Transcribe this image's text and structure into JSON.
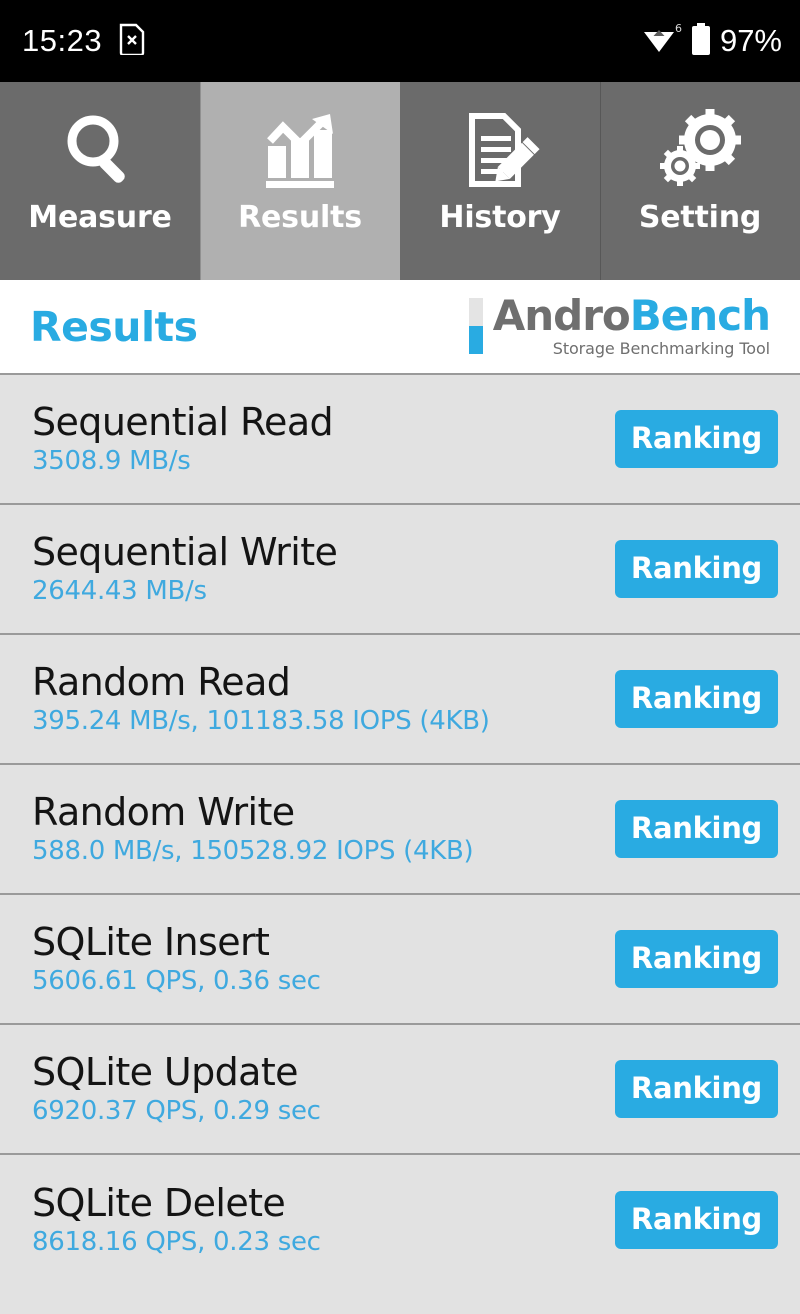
{
  "status_bar": {
    "time": "15:23",
    "sim_icon": "sim-card-off-icon",
    "wifi_icon": "wifi-6-icon",
    "wifi_generation": "6",
    "battery_icon": "battery-icon",
    "battery_percent": "97%"
  },
  "tabs": [
    {
      "label": "Measure",
      "icon": "magnifier-icon",
      "selected": false
    },
    {
      "label": "Results",
      "icon": "bar-chart-trend-icon",
      "selected": true
    },
    {
      "label": "History",
      "icon": "document-pencil-icon",
      "selected": false
    },
    {
      "label": "Setting",
      "icon": "gears-icon",
      "selected": false
    }
  ],
  "header": {
    "page_title": "Results",
    "logo": {
      "name_first": "Andro",
      "name_second": "Bench",
      "tagline": "Storage Benchmarking Tool"
    }
  },
  "results": [
    {
      "title": "Sequential Read",
      "value": "3508.9 MB/s",
      "button": "Ranking"
    },
    {
      "title": "Sequential Write",
      "value": "2644.43 MB/s",
      "button": "Ranking"
    },
    {
      "title": "Random Read",
      "value": "395.24 MB/s, 101183.58 IOPS (4KB)",
      "button": "Ranking"
    },
    {
      "title": "Random Write",
      "value": "588.0 MB/s, 150528.92 IOPS (4KB)",
      "button": "Ranking"
    },
    {
      "title": "SQLite Insert",
      "value": "5606.61 QPS, 0.36 sec",
      "button": "Ranking"
    },
    {
      "title": "SQLite Update",
      "value": "6920.37 QPS, 0.29 sec",
      "button": "Ranking"
    },
    {
      "title": "SQLite Delete",
      "value": "8618.16 QPS, 0.23 sec",
      "button": "Ranking"
    }
  ],
  "colors": {
    "accent_blue": "#29ABE2",
    "value_blue": "#3FA9DF",
    "row_bg": "#E2E2E2",
    "tab_unselected": "#6B6B6B",
    "tab_selected": "#B0B0B0",
    "status_bar_bg": "#000000",
    "logo_gray": "#6F6F6F"
  }
}
